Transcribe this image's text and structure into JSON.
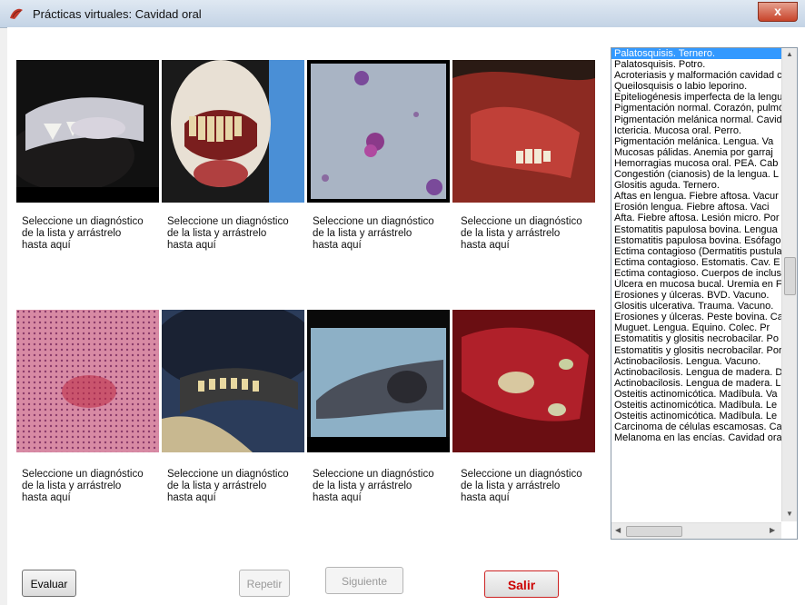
{
  "window": {
    "title": "Prácticas virtuales: Cavidad oral",
    "close_glyph": "x"
  },
  "drop_text": "Seleccione un diagnóstico de la lista y arrástrelo hasta aquí",
  "diagnoses": [
    "Palatosquisis. Ternero.",
    "Palatosquisis. Potro.",
    "Acroteriasis y malformación cavidad c",
    "Queilosquisis  o  labio leporino.",
    "Epiteliogénesis imperfecta de la lengu",
    "Pigmentación normal. Corazón, pulmó",
    "Pigmentación melánica normal. Cavid",
    "Ictericia. Mucosa oral. Perro.",
    "Pigmentación melánica.   Lengua.  Va",
    "Mucosas pálidas.  Anemia por garraj",
    "Hemorragias mucosa oral. PEA. Cab",
    "Congestión (cianosis) de la lengua.  L",
    "Glositis aguda. Ternero.",
    "Aftas en lengua. Fiebre aftosa. Vacur",
    " Erosión lengua.  Fiebre  aftosa.  Vaci",
    " Afta. Fiebre aftosa. Lesión micro. Por",
    "Estomatitis papulosa bovina. Lengua",
    "Estomatitis papulosa bovina. Esófago",
    "Ectima contagioso (Dermatitis pustula",
    "Ectima contagioso. Estomatis. Cav.  E",
    "Ectima contagioso. Cuerpos de inclus",
    "Úlcera en mucosa bucal. Uremia en F",
    "Erosiones y úlceras. BVD. Vacuno.",
    "Glositis ulcerativa. Trauma. Vacuno.",
    "Erosiones y úlceras. Peste bovina. Ca",
    "Muguet. Lengua. Equino.   Colec. Pr",
    "Estomatitis y  glositis necrobacilar. Po",
    "Estomatitis y glositis necrobacilar. Por",
    "Actinobacilosis. Lengua. Vacuno.",
    "Actinobacilosis. Lengua de madera. D",
    "Actinobacilosis. Lengua de madera. L",
    "Osteitis actinomicótica. Madíbula. Va",
    "Osteitis actinomicótica. Madíbula. Le",
    "Osteitis actinomicótica. Madíbula. Le",
    "Carcinoma de células escamosas. Ca",
    "Melanoma en las encías. Cavidad ora"
  ],
  "buttons": {
    "evaluate": "Evaluar",
    "repeat": "Repetir",
    "next": "Siguiente",
    "exit": "Salir"
  },
  "colors": {
    "selection": "#3399ff",
    "exit_text": "#cc0000"
  }
}
